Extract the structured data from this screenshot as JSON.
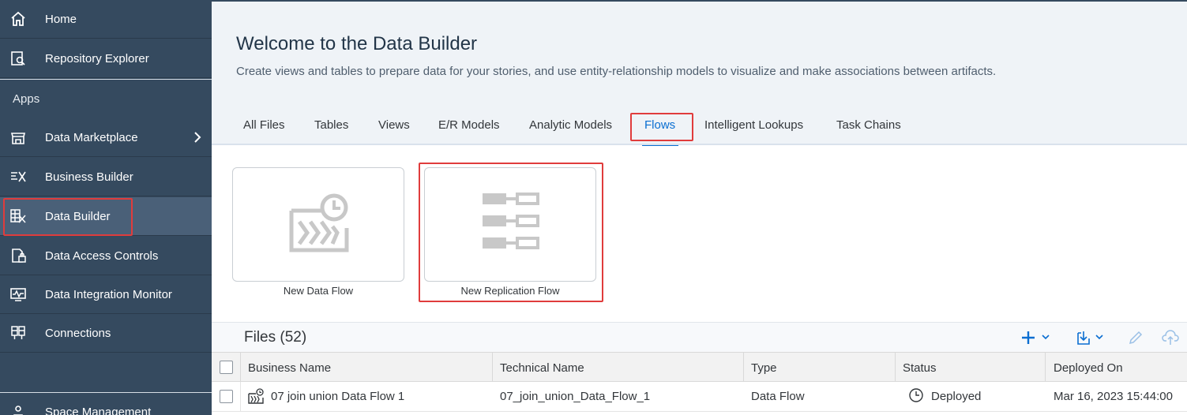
{
  "sidebar": {
    "items": [
      {
        "label": "Home",
        "icon": "home-icon"
      },
      {
        "label": "Repository Explorer",
        "icon": "repository-icon"
      },
      {
        "label": "Data Marketplace",
        "icon": "marketplace-icon"
      },
      {
        "label": "Business Builder",
        "icon": "business-builder-icon"
      },
      {
        "label": "Data Builder",
        "icon": "data-builder-icon"
      },
      {
        "label": "Data Access Controls",
        "icon": "access-controls-icon"
      },
      {
        "label": "Data Integration Monitor",
        "icon": "monitor-icon"
      },
      {
        "label": "Connections",
        "icon": "connections-icon"
      },
      {
        "label": "Space Management",
        "icon": "space-management-icon"
      }
    ],
    "apps_label": "Apps",
    "active_item": "Data Builder"
  },
  "header": {
    "title": "Welcome to the Data Builder",
    "subtitle": "Create views and tables to prepare data for your stories, and use entity-relationship models to visualize and make associations between artifacts."
  },
  "tabs": [
    {
      "label": "All Files"
    },
    {
      "label": "Tables"
    },
    {
      "label": "Views"
    },
    {
      "label": "E/R Models"
    },
    {
      "label": "Analytic Models"
    },
    {
      "label": "Flows"
    },
    {
      "label": "Intelligent Lookups"
    },
    {
      "label": "Task Chains"
    }
  ],
  "active_tab": "Flows",
  "tiles": [
    {
      "label": "New Data Flow",
      "icon": "data-flow-icon"
    },
    {
      "label": "New Replication Flow",
      "icon": "replication-flow-icon"
    }
  ],
  "files": {
    "title": "Files (52)",
    "columns": [
      "Business Name",
      "Technical Name",
      "Type",
      "Status",
      "Deployed On"
    ],
    "rows": [
      {
        "business_name": "07 join union Data Flow 1",
        "technical_name": "07_join_union_Data_Flow_1",
        "type": "Data Flow",
        "status": "Deployed",
        "deployed_on": "Mar 16, 2023 15:44:00"
      }
    ]
  },
  "colors": {
    "sidebar_bg": "#354a5f",
    "accent": "#0a6ed1",
    "highlight": "#e03c3c"
  }
}
